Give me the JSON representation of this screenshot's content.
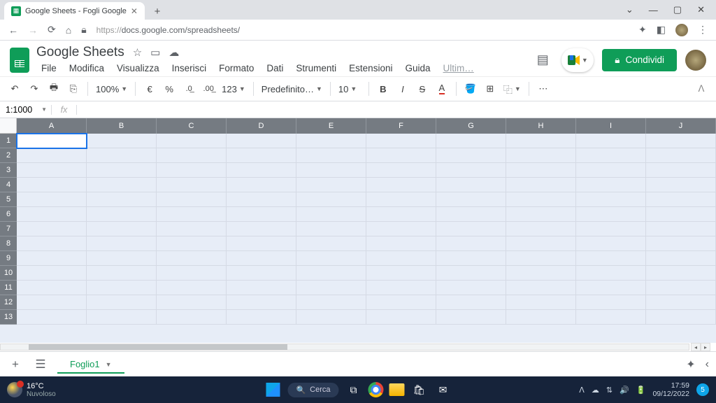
{
  "browser": {
    "tab_title": "Google Sheets - Fogli Google",
    "url_prefix": "https://",
    "url_main": "docs.google.com/spreadsheets/"
  },
  "doc": {
    "title": "Google Sheets",
    "menus": [
      "File",
      "Modifica",
      "Visualizza",
      "Inserisci",
      "Formato",
      "Dati",
      "Strumenti",
      "Estensioni",
      "Guida"
    ],
    "menu_extra": "Ultim…",
    "share": "Condividi"
  },
  "toolbar": {
    "zoom": "100%",
    "currency": "€",
    "percent": "%",
    "dec_less": ".0",
    "dec_more": ".00",
    "num_format": "123",
    "font": "Predefinito…",
    "font_size": "10"
  },
  "namebox": "1:1000",
  "columns": [
    "A",
    "B",
    "C",
    "D",
    "E",
    "F",
    "G",
    "H",
    "I",
    "J"
  ],
  "rows": 13,
  "sheet_tab": "Foglio1",
  "taskbar": {
    "temp": "16°C",
    "weather": "Nuvoloso",
    "search": "Cerca",
    "time": "17:59",
    "date": "09/12/2022",
    "notif": "5"
  }
}
